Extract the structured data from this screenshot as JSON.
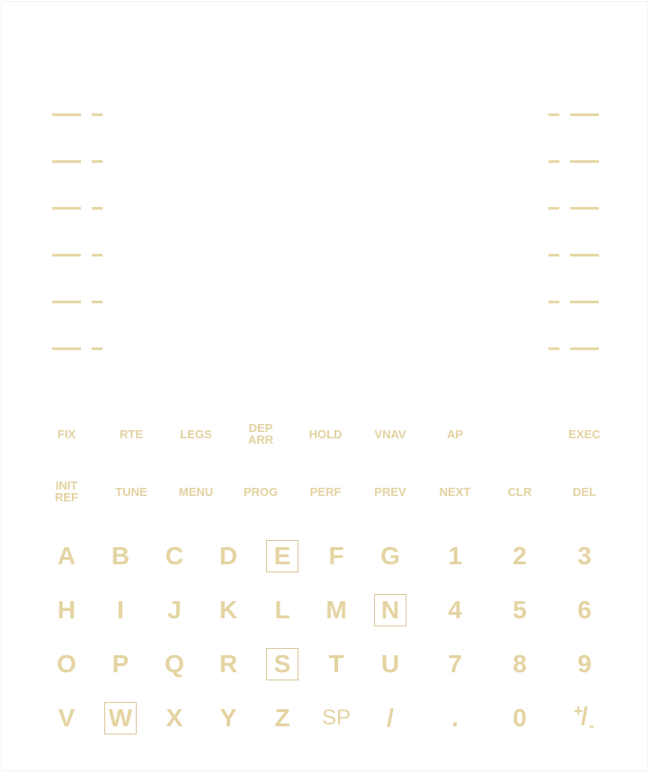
{
  "function_keys_row1": [
    "FIX",
    "RTE",
    "LEGS",
    "DEP\nARR",
    "HOLD",
    "VNAV",
    "AP",
    "",
    "EXEC"
  ],
  "function_keys_row2": [
    "INIT\nREF",
    "TUNE",
    "MENU",
    "PROG",
    "PERF",
    "PREV",
    "NEXT",
    "CLR",
    "DEL"
  ],
  "keypad_rows": [
    [
      "A",
      "B",
      "C",
      "D",
      "E",
      "F",
      "G",
      "1",
      "2",
      "3"
    ],
    [
      "H",
      "I",
      "J",
      "K",
      "L",
      "M",
      "N",
      "4",
      "5",
      "6"
    ],
    [
      "O",
      "P",
      "Q",
      "R",
      "S",
      "T",
      "U",
      "7",
      "8",
      "9"
    ],
    [
      "V",
      "W",
      "X",
      "Y",
      "Z",
      "SP",
      "/",
      ".",
      "0"
    ]
  ],
  "plus_minus": {
    "plus": "+",
    "slash": "/",
    "minus": "-"
  },
  "highlighted_keys": [
    "E",
    "N",
    "S",
    "W"
  ],
  "colors": {
    "key_text": "#e4d4a2",
    "dash": "#e6d8a6"
  }
}
